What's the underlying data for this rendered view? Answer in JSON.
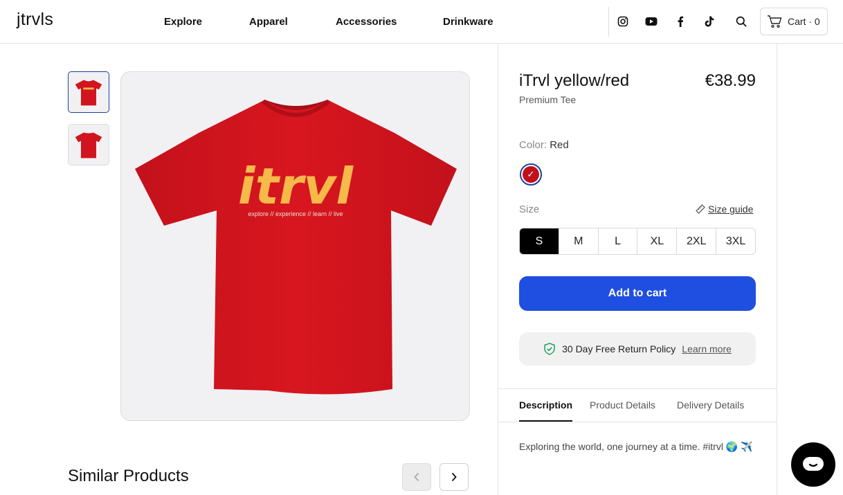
{
  "header": {
    "logo": "jtrvls",
    "nav": [
      "Explore",
      "Apparel",
      "Accessories",
      "Drinkware"
    ],
    "icons": [
      "instagram-icon",
      "youtube-icon",
      "facebook-icon",
      "tiktok-icon",
      "search-icon"
    ],
    "cart_label": "Cart · 0"
  },
  "gallery": {
    "shirt_print": "itrvl",
    "shirt_tagline": "explore // experience // learn // live",
    "shirt_color": "#d0151f",
    "print_color": "#f6b94a"
  },
  "similar": {
    "heading": "Similar Products"
  },
  "product": {
    "title": "iTrvl yellow/red",
    "price": "€38.99",
    "subtitle": "Premium Tee",
    "color_label": "Color:",
    "color_value": "Red",
    "size_label": "Size",
    "size_guide": "Size guide",
    "sizes": [
      "S",
      "M",
      "L",
      "XL",
      "2XL",
      "3XL"
    ],
    "selected_size": "S",
    "add_to_cart": "Add to cart",
    "policy_text": "30 Day Free Return Policy",
    "policy_link": "Learn more",
    "tabs": [
      "Description",
      "Product Details",
      "Delivery Details"
    ],
    "description": "Exploring the world, one journey at a time. #itrvl 🌍 ✈️",
    "accent": "#1f4fe0"
  }
}
